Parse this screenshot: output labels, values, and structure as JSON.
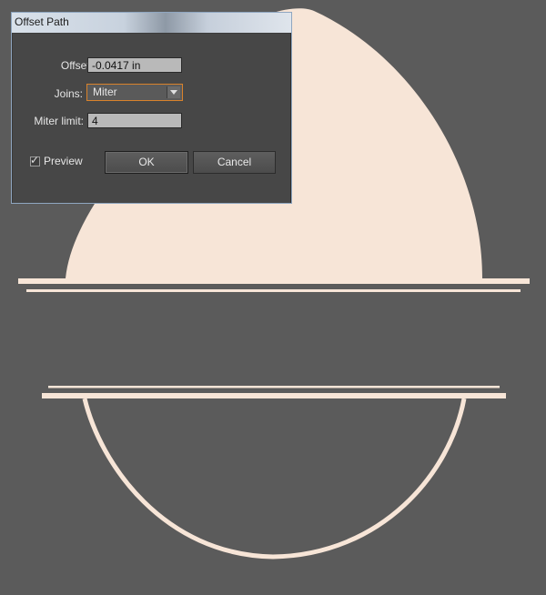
{
  "dialog": {
    "title": "Offset Path",
    "offset_label": "Offset:",
    "offset_value": "-0.0417 in",
    "joins_label": "Joins:",
    "joins_value": "Miter",
    "miter_label": "Miter limit:",
    "miter_value": "4",
    "preview_label": "Preview",
    "preview_checked": true,
    "ok_label": "OK",
    "cancel_label": "Cancel"
  },
  "colors": {
    "canvas": "#5b5b5b",
    "shape_fill": "#f7e5d7",
    "focus_outline": "#d9822b"
  }
}
